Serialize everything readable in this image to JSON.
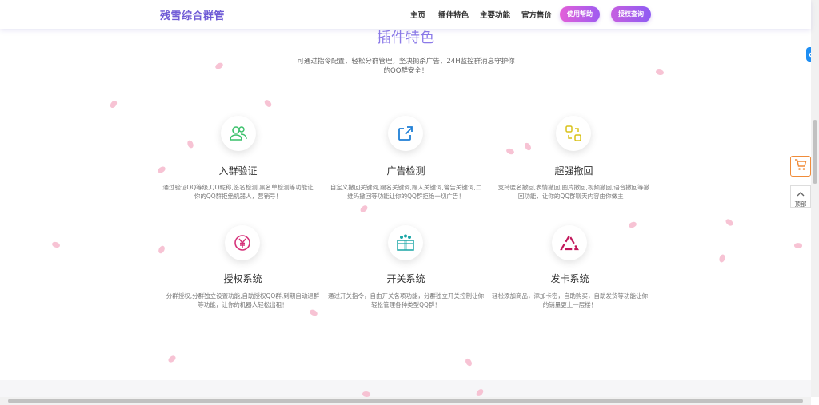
{
  "header": {
    "brand": "残雪综合群管",
    "nav": [
      "主页",
      "插件特色",
      "主要功能",
      "官方售价"
    ],
    "help_label": "使用帮助",
    "auth_label": "授权查询"
  },
  "section": {
    "title": "插件特色",
    "subtitle": "可通过指令配置，轻松分群管理，坚决扼杀广告，24H监控群消息守护你的QQ群安全！"
  },
  "features": [
    {
      "icon": "users-icon",
      "title": "入群验证",
      "desc": "通过验证QQ等级,QQ昵称,签名检测,黑名单检测等功能让你的QQ群拒绝机器人，营销号！"
    },
    {
      "icon": "share-icon",
      "title": "广告检测",
      "desc": "自定义撤回关键词,踢名关键词,踢人关键词,警告关键词,二维码撤回等功能让你的QQ群拒绝一切广告！"
    },
    {
      "icon": "swap-icon",
      "title": "超强撤回",
      "desc": "支持匿名撤回,表情撤回,图片撤回,视频撤回,语音撤回等撤回功能，让你的QQ群聊天内容由你做主！"
    },
    {
      "icon": "yen-icon",
      "title": "授权系统",
      "desc": "分群授权,分群独立设置功能,自助授权QQ群,到期自动退群等功能，让你的机器人轻松出租！"
    },
    {
      "icon": "gift-box-icon",
      "title": "开关系统",
      "desc": "通过开关指令，自由开关各项功能，分群独立开关控制让你轻松管理各种类型QQ群！"
    },
    {
      "icon": "triangle-icon",
      "title": "发卡系统",
      "desc": "轻松添加商品，添加卡密，自助购买，自助发货等功能让你的销量更上一层楼！"
    }
  ],
  "side": {
    "cart_icon": "cart-icon",
    "top_label": "顶部"
  },
  "colors": {
    "accent": "#8b7ae8",
    "pill_start": "#e35fd8",
    "pill_end": "#9f5cf0",
    "cart": "#f08c3a",
    "petal": "#f6b9cc"
  }
}
